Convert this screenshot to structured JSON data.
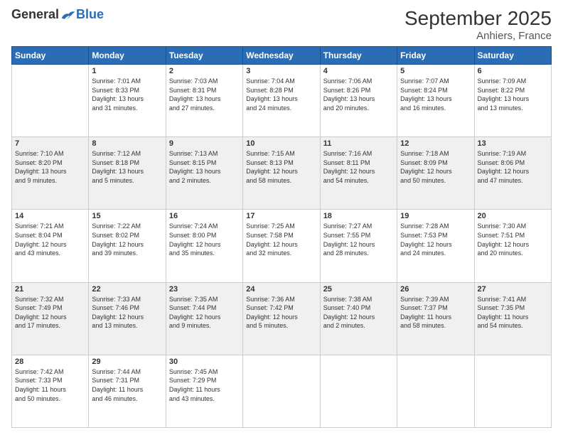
{
  "logo": {
    "general": "General",
    "blue": "Blue"
  },
  "title": "September 2025",
  "subtitle": "Anhiers, France",
  "days_of_week": [
    "Sunday",
    "Monday",
    "Tuesday",
    "Wednesday",
    "Thursday",
    "Friday",
    "Saturday"
  ],
  "weeks": [
    [
      {
        "num": "",
        "info": ""
      },
      {
        "num": "1",
        "info": "Sunrise: 7:01 AM\nSunset: 8:33 PM\nDaylight: 13 hours\nand 31 minutes."
      },
      {
        "num": "2",
        "info": "Sunrise: 7:03 AM\nSunset: 8:31 PM\nDaylight: 13 hours\nand 27 minutes."
      },
      {
        "num": "3",
        "info": "Sunrise: 7:04 AM\nSunset: 8:28 PM\nDaylight: 13 hours\nand 24 minutes."
      },
      {
        "num": "4",
        "info": "Sunrise: 7:06 AM\nSunset: 8:26 PM\nDaylight: 13 hours\nand 20 minutes."
      },
      {
        "num": "5",
        "info": "Sunrise: 7:07 AM\nSunset: 8:24 PM\nDaylight: 13 hours\nand 16 minutes."
      },
      {
        "num": "6",
        "info": "Sunrise: 7:09 AM\nSunset: 8:22 PM\nDaylight: 13 hours\nand 13 minutes."
      }
    ],
    [
      {
        "num": "7",
        "info": "Sunrise: 7:10 AM\nSunset: 8:20 PM\nDaylight: 13 hours\nand 9 minutes."
      },
      {
        "num": "8",
        "info": "Sunrise: 7:12 AM\nSunset: 8:18 PM\nDaylight: 13 hours\nand 5 minutes."
      },
      {
        "num": "9",
        "info": "Sunrise: 7:13 AM\nSunset: 8:15 PM\nDaylight: 13 hours\nand 2 minutes."
      },
      {
        "num": "10",
        "info": "Sunrise: 7:15 AM\nSunset: 8:13 PM\nDaylight: 12 hours\nand 58 minutes."
      },
      {
        "num": "11",
        "info": "Sunrise: 7:16 AM\nSunset: 8:11 PM\nDaylight: 12 hours\nand 54 minutes."
      },
      {
        "num": "12",
        "info": "Sunrise: 7:18 AM\nSunset: 8:09 PM\nDaylight: 12 hours\nand 50 minutes."
      },
      {
        "num": "13",
        "info": "Sunrise: 7:19 AM\nSunset: 8:06 PM\nDaylight: 12 hours\nand 47 minutes."
      }
    ],
    [
      {
        "num": "14",
        "info": "Sunrise: 7:21 AM\nSunset: 8:04 PM\nDaylight: 12 hours\nand 43 minutes."
      },
      {
        "num": "15",
        "info": "Sunrise: 7:22 AM\nSunset: 8:02 PM\nDaylight: 12 hours\nand 39 minutes."
      },
      {
        "num": "16",
        "info": "Sunrise: 7:24 AM\nSunset: 8:00 PM\nDaylight: 12 hours\nand 35 minutes."
      },
      {
        "num": "17",
        "info": "Sunrise: 7:25 AM\nSunset: 7:58 PM\nDaylight: 12 hours\nand 32 minutes."
      },
      {
        "num": "18",
        "info": "Sunrise: 7:27 AM\nSunset: 7:55 PM\nDaylight: 12 hours\nand 28 minutes."
      },
      {
        "num": "19",
        "info": "Sunrise: 7:28 AM\nSunset: 7:53 PM\nDaylight: 12 hours\nand 24 minutes."
      },
      {
        "num": "20",
        "info": "Sunrise: 7:30 AM\nSunset: 7:51 PM\nDaylight: 12 hours\nand 20 minutes."
      }
    ],
    [
      {
        "num": "21",
        "info": "Sunrise: 7:32 AM\nSunset: 7:49 PM\nDaylight: 12 hours\nand 17 minutes."
      },
      {
        "num": "22",
        "info": "Sunrise: 7:33 AM\nSunset: 7:46 PM\nDaylight: 12 hours\nand 13 minutes."
      },
      {
        "num": "23",
        "info": "Sunrise: 7:35 AM\nSunset: 7:44 PM\nDaylight: 12 hours\nand 9 minutes."
      },
      {
        "num": "24",
        "info": "Sunrise: 7:36 AM\nSunset: 7:42 PM\nDaylight: 12 hours\nand 5 minutes."
      },
      {
        "num": "25",
        "info": "Sunrise: 7:38 AM\nSunset: 7:40 PM\nDaylight: 12 hours\nand 2 minutes."
      },
      {
        "num": "26",
        "info": "Sunrise: 7:39 AM\nSunset: 7:37 PM\nDaylight: 11 hours\nand 58 minutes."
      },
      {
        "num": "27",
        "info": "Sunrise: 7:41 AM\nSunset: 7:35 PM\nDaylight: 11 hours\nand 54 minutes."
      }
    ],
    [
      {
        "num": "28",
        "info": "Sunrise: 7:42 AM\nSunset: 7:33 PM\nDaylight: 11 hours\nand 50 minutes."
      },
      {
        "num": "29",
        "info": "Sunrise: 7:44 AM\nSunset: 7:31 PM\nDaylight: 11 hours\nand 46 minutes."
      },
      {
        "num": "30",
        "info": "Sunrise: 7:45 AM\nSunset: 7:29 PM\nDaylight: 11 hours\nand 43 minutes."
      },
      {
        "num": "",
        "info": ""
      },
      {
        "num": "",
        "info": ""
      },
      {
        "num": "",
        "info": ""
      },
      {
        "num": "",
        "info": ""
      }
    ]
  ]
}
